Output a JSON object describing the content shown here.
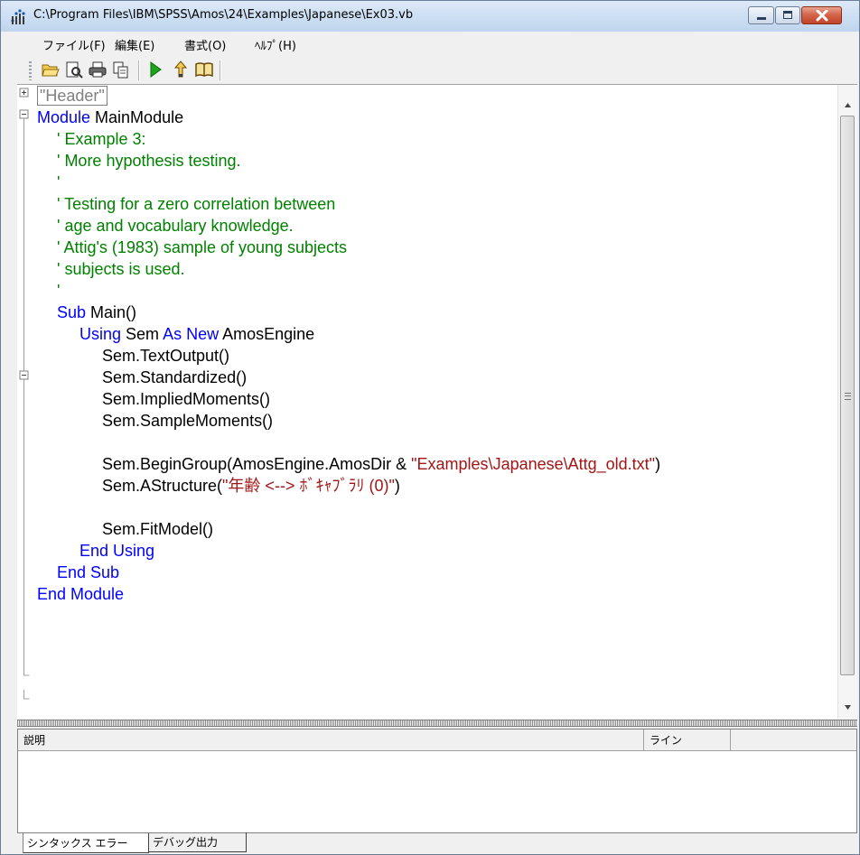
{
  "window": {
    "title": "C:\\Program Files\\IBM\\SPSS\\Amos\\24\\Examples\\Japanese\\Ex03.vb"
  },
  "menu": [
    "ファイル(F)",
    "編集(E)",
    "書式(O)",
    "ﾍﾙﾌﾟ(H)"
  ],
  "toolbar": {
    "icons": [
      "open-folder-icon",
      "print-preview-icon",
      "print-icon",
      "copy-icon",
      "run-icon",
      "step-icon",
      "book-icon"
    ]
  },
  "editor": {
    "collapsed_region": "\"Header\"",
    "lines": [
      [
        {
          "t": "Module ",
          "c": "kw"
        },
        {
          "t": "MainModule",
          "c": "tx"
        }
      ],
      [
        {
          "t": "' Example 3:",
          "c": "cm"
        }
      ],
      [
        {
          "t": "' More hypothesis testing.",
          "c": "cm"
        }
      ],
      [
        {
          "t": "'",
          "c": "cm"
        }
      ],
      [
        {
          "t": "' Testing for a zero correlation between",
          "c": "cm"
        }
      ],
      [
        {
          "t": "' age and vocabulary knowledge.",
          "c": "cm"
        }
      ],
      [
        {
          "t": "' Attig's (1983) sample of young subjects",
          "c": "cm"
        }
      ],
      [
        {
          "t": "' subjects is used.",
          "c": "cm"
        }
      ],
      [
        {
          "t": "'",
          "c": "cm"
        }
      ],
      [
        {
          "t": "Sub ",
          "c": "kw"
        },
        {
          "t": "Main()",
          "c": "tx"
        }
      ],
      [
        {
          "t": "Using ",
          "c": "kw"
        },
        {
          "t": "Sem ",
          "c": "tx"
        },
        {
          "t": "As New ",
          "c": "kw"
        },
        {
          "t": "AmosEngine",
          "c": "tx"
        }
      ],
      [
        {
          "t": "Sem.TextOutput()",
          "c": "tx"
        }
      ],
      [
        {
          "t": "Sem.Standardized()",
          "c": "tx"
        }
      ],
      [
        {
          "t": "Sem.ImpliedMoments()",
          "c": "tx"
        }
      ],
      [
        {
          "t": "Sem.SampleMoments()",
          "c": "tx"
        }
      ],
      [],
      [
        {
          "t": "Sem.BeginGroup(AmosEngine.AmosDir & ",
          "c": "tx"
        },
        {
          "t": "\"Examples\\Japanese\\Attg_old.txt\"",
          "c": "st"
        },
        {
          "t": ")",
          "c": "tx"
        }
      ],
      [
        {
          "t": "Sem.AStructure(",
          "c": "tx"
        },
        {
          "t": "\"年齢 <--> ﾎﾞｷｬﾌﾞﾗﾘ (0)\"",
          "c": "st"
        },
        {
          "t": ")",
          "c": "tx"
        }
      ],
      [],
      [
        {
          "t": "Sem.FitModel()",
          "c": "tx"
        }
      ],
      [
        {
          "t": "End Using",
          "c": "kw"
        }
      ],
      [
        {
          "t": "End Sub",
          "c": "kw"
        }
      ],
      [
        {
          "t": "End Module",
          "c": "kw"
        }
      ]
    ]
  },
  "colors": {
    "keyword": "#0000ff",
    "comment": "#008000",
    "string": "#a31515"
  },
  "error_panel": {
    "columns": [
      "説明",
      "ライン",
      ""
    ]
  },
  "tabs": [
    "シンタックス エラー",
    "デバッグ出力"
  ]
}
